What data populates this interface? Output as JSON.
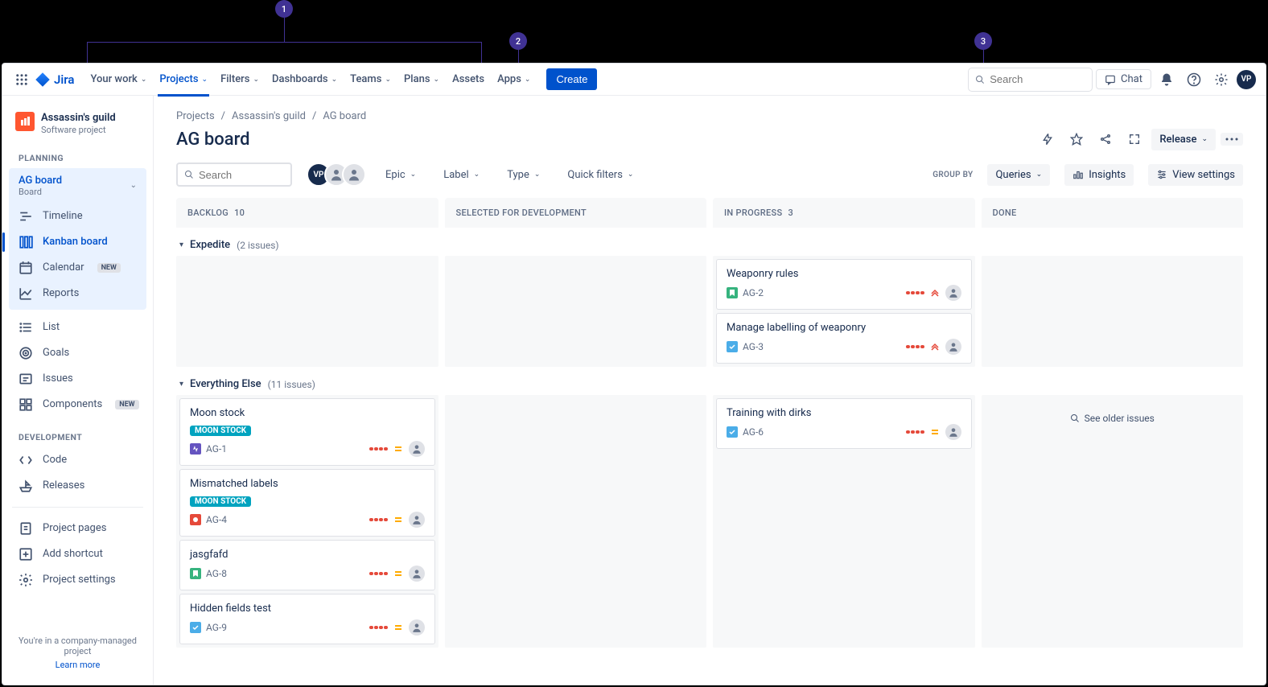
{
  "callouts": {
    "c1": "1",
    "c2": "2",
    "c3": "3"
  },
  "topnav": {
    "logo": "Jira",
    "items": [
      "Your work",
      "Projects",
      "Filters",
      "Dashboards",
      "Teams",
      "Plans",
      "Assets",
      "Apps"
    ],
    "active_index": 1,
    "create": "Create",
    "search_placeholder": "Search",
    "chat": "Chat",
    "avatar_initials": "VP"
  },
  "sidebar": {
    "project": {
      "name": "Assassin's guild",
      "type": "Software project"
    },
    "sections": {
      "planning": {
        "label": "PLANNING",
        "current_view": {
          "label": "AG board",
          "sublabel": "Board"
        },
        "items": [
          {
            "icon": "timeline",
            "label": "Timeline",
            "selected": false
          },
          {
            "icon": "board",
            "label": "Kanban board",
            "selected": true
          },
          {
            "icon": "calendar",
            "label": "Calendar",
            "badge": "NEW"
          },
          {
            "icon": "chart",
            "label": "Reports"
          }
        ],
        "items2": [
          {
            "icon": "list",
            "label": "List"
          },
          {
            "icon": "target",
            "label": "Goals"
          },
          {
            "icon": "issues",
            "label": "Issues"
          },
          {
            "icon": "component",
            "label": "Components",
            "badge": "NEW"
          }
        ]
      },
      "development": {
        "label": "DEVELOPMENT",
        "items": [
          {
            "icon": "code",
            "label": "Code"
          },
          {
            "icon": "ship",
            "label": "Releases"
          }
        ]
      },
      "footer_items": [
        {
          "icon": "page",
          "label": "Project pages"
        },
        {
          "icon": "shortcut",
          "label": "Add shortcut"
        },
        {
          "icon": "settings",
          "label": "Project settings"
        }
      ]
    },
    "footer_text": "You're in a company-managed project",
    "footer_link": "Learn more"
  },
  "breadcrumbs": [
    "Projects",
    "Assassin's guild",
    "AG board"
  ],
  "page": {
    "title": "AG board",
    "release_btn": "Release"
  },
  "toolbar": {
    "search_placeholder": "Search",
    "avatar_initials": "VP",
    "filters": [
      "Epic",
      "Label",
      "Type",
      "Quick filters"
    ],
    "groupby_label": "GROUP BY",
    "groupby_value": "Queries",
    "insights": "Insights",
    "view_settings": "View settings"
  },
  "columns": [
    {
      "name": "BACKLOG",
      "count": 10
    },
    {
      "name": "SELECTED FOR DEVELOPMENT",
      "count": null
    },
    {
      "name": "IN PROGRESS",
      "count": 3
    },
    {
      "name": "DONE",
      "count": null
    }
  ],
  "swimlanes": [
    {
      "title": "Expedite",
      "count_text": "(2 issues)",
      "cells": [
        [],
        [],
        [
          {
            "title": "Weaponry rules",
            "key": "AG-2",
            "type": "story",
            "priority": "highest"
          },
          {
            "title": "Manage labelling of weaponry",
            "key": "AG-3",
            "type": "task",
            "priority": "highest"
          }
        ],
        []
      ]
    },
    {
      "title": "Everything Else",
      "count_text": "(11 issues)",
      "cells": [
        [
          {
            "title": "Moon stock",
            "epic": "MOON STOCK",
            "key": "AG-1",
            "type": "epic",
            "priority": "medium"
          },
          {
            "title": "Mismatched labels",
            "epic": "MOON STOCK",
            "key": "AG-4",
            "type": "bug",
            "priority": "medium"
          },
          {
            "title": "jasgfafd",
            "key": "AG-8",
            "type": "story",
            "priority": "medium"
          },
          {
            "title": "Hidden fields test",
            "key": "AG-9",
            "type": "task",
            "priority": "medium"
          }
        ],
        [],
        [
          {
            "title": "Training with dirks",
            "key": "AG-6",
            "type": "task",
            "priority": "medium"
          }
        ],
        []
      ],
      "done_older": "See older issues"
    }
  ]
}
